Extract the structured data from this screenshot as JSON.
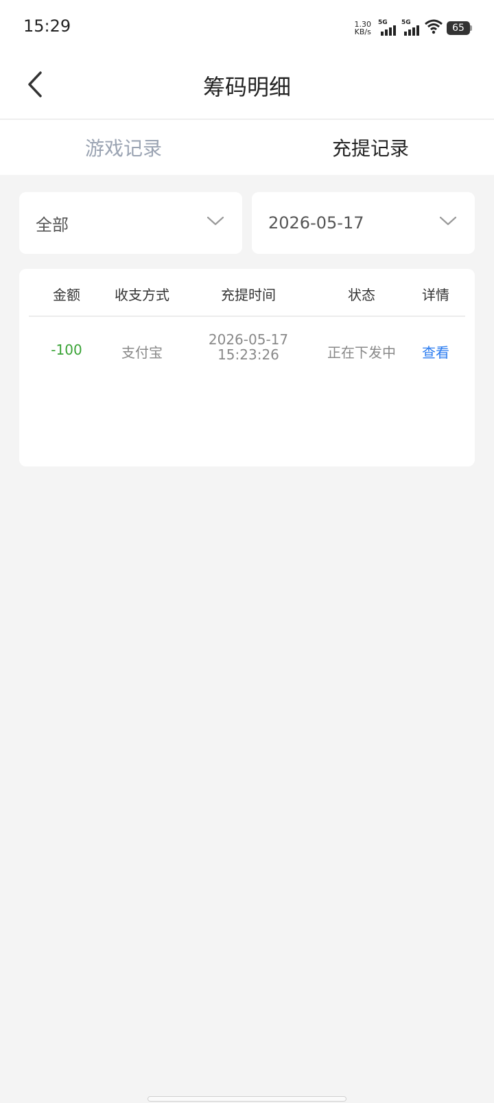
{
  "status_bar": {
    "time": "15:29",
    "net_speed_value": "1.30",
    "net_speed_unit": "KB/s",
    "signal1_tag": "5G",
    "signal2_tag": "5G",
    "battery_level": "65",
    "icons": [
      "signal-5g-icon",
      "signal-5g-icon",
      "wifi-icon",
      "battery-icon"
    ]
  },
  "header": {
    "title": "筹码明细",
    "back_icon": "chevron-left-icon"
  },
  "tabs": [
    {
      "label": "游戏记录",
      "active": false
    },
    {
      "label": "充提记录",
      "active": true
    }
  ],
  "filters": {
    "type": {
      "value": "全部",
      "icon": "chevron-down-icon"
    },
    "date": {
      "value": "2026-05-17",
      "icon": "chevron-down-icon"
    }
  },
  "table": {
    "headers": [
      "金额",
      "收支方式",
      "充提时间",
      "状态",
      "详情"
    ],
    "rows": [
      {
        "amount": "-100",
        "method": "支付宝",
        "date": "2026-05-17",
        "time": "15:23:26",
        "status": "正在下发中",
        "detail": "查看"
      }
    ]
  },
  "colors": {
    "accent_blue": "#2b7cf0",
    "amount_green": "#3aa336",
    "inactive_tab": "#9aa3b2",
    "page_bg": "#f4f4f4"
  }
}
